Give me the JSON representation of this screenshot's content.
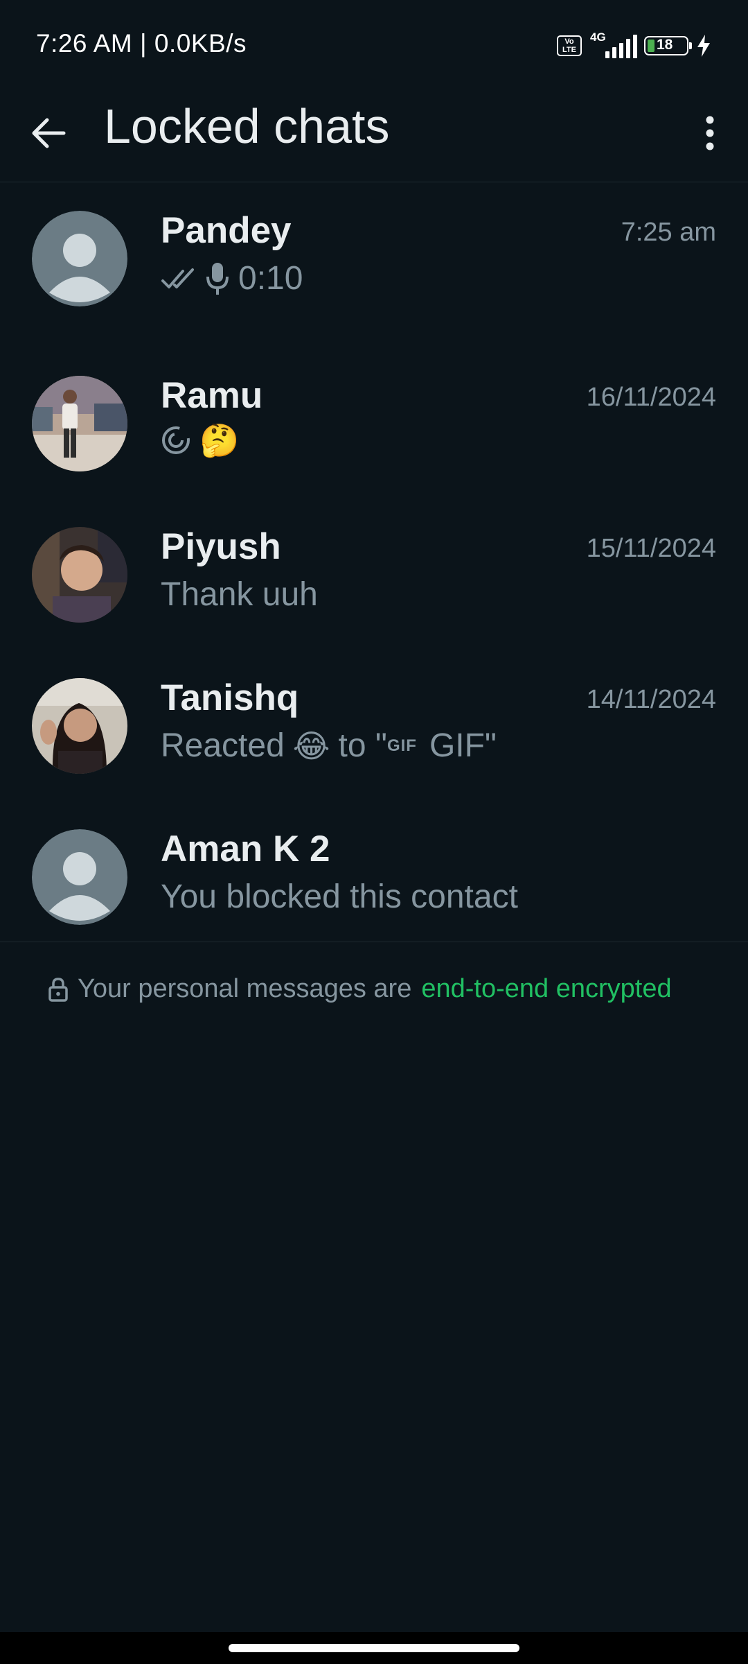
{
  "status_bar": {
    "time_text": "7:26 AM | 0.0KB/s",
    "network_label": "4G",
    "volte_label": "Vo LTE",
    "battery_level": "18"
  },
  "app_bar": {
    "title": "Locked chats"
  },
  "chats": [
    {
      "name": "Pandey",
      "time": "7:25 am",
      "preview": "0:10",
      "preview_icons": [
        "double-check-icon",
        "microphone-icon"
      ]
    },
    {
      "name": "Ramu",
      "time": "16/11/2024",
      "preview_emoji": "🤔",
      "preview_icons": [
        "view-once-icon"
      ]
    },
    {
      "name": "Piyush",
      "time": "15/11/2024",
      "preview": "Thank uuh"
    },
    {
      "name": "Tanishq",
      "time": "14/11/2024",
      "preview_before": "Reacted",
      "preview_emoji": "😂",
      "preview_mid": "to \"",
      "gif_tag": "GIF",
      "preview_after": "GIF\""
    },
    {
      "name": "Aman K 2",
      "time": "",
      "preview": "You blocked this contact"
    }
  ],
  "footer": {
    "encryption_text": "Your personal messages are",
    "encryption_link": "end-to-end encrypted"
  },
  "colors": {
    "background": "#0b141a",
    "accent_green": "#21c063",
    "secondary_text": "#8696a0",
    "primary_text": "#e9edef"
  }
}
